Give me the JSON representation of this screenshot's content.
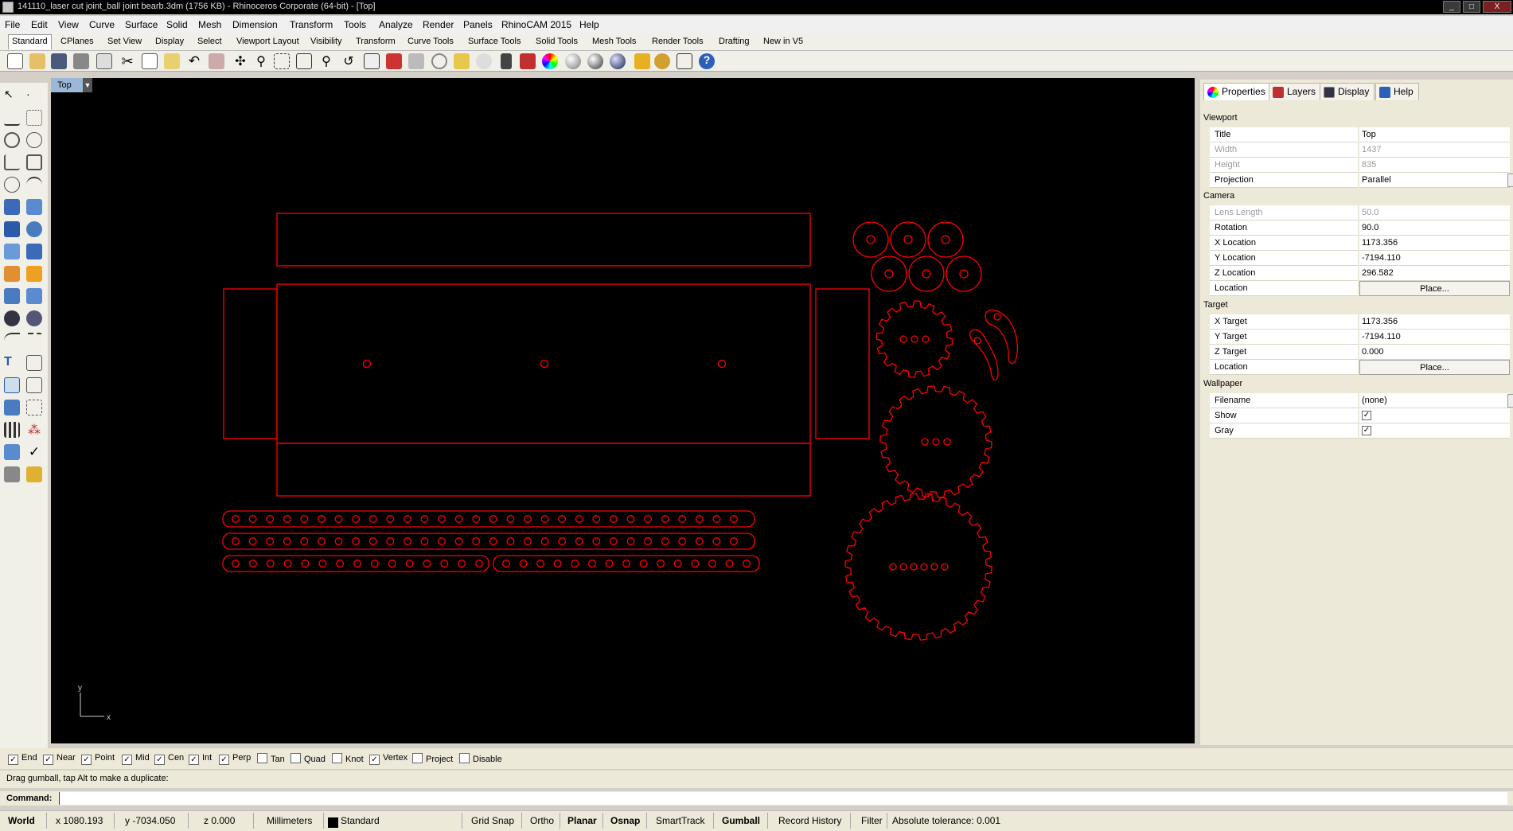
{
  "window": {
    "title": "141110_laser cut joint_ball joint bearb.3dm (1756 KB) - Rhinoceros Corporate (64-bit) - [Top]",
    "min": "_",
    "max": "□",
    "close": "X"
  },
  "menu": [
    "File",
    "Edit",
    "View",
    "Curve",
    "Surface",
    "Solid",
    "Mesh",
    "Dimension",
    "Transform",
    "Tools",
    "Analyze",
    "Render",
    "Panels",
    "RhinoCAM 2015",
    "Help"
  ],
  "toolbar_tabs": [
    "Standard",
    "CPlanes",
    "Set View",
    "Display",
    "Select",
    "Viewport Layout",
    "Visibility",
    "Transform",
    "Curve Tools",
    "Surface Tools",
    "Solid Tools",
    "Mesh Tools",
    "Render Tools",
    "Drafting",
    "New in V5"
  ],
  "viewport": {
    "label": "Top",
    "axis_x": "x",
    "axis_y": "y"
  },
  "panel": {
    "tabs": [
      "Properties",
      "Layers",
      "Display",
      "Help"
    ],
    "sections": {
      "viewport": "Viewport",
      "camera": "Camera",
      "target": "Target",
      "wallpaper": "Wallpaper"
    },
    "viewport": [
      {
        "k": "Title",
        "v": "Top"
      },
      {
        "k": "Width",
        "v": "1437"
      },
      {
        "k": "Height",
        "v": "835"
      },
      {
        "k": "Projection",
        "v": "Parallel"
      }
    ],
    "camera": [
      {
        "k": "Lens Length",
        "v": "50.0"
      },
      {
        "k": "Rotation",
        "v": "90.0"
      },
      {
        "k": "X Location",
        "v": "1173.356"
      },
      {
        "k": "Y Location",
        "v": "-7194.110"
      },
      {
        "k": "Z Location",
        "v": "296.582"
      },
      {
        "k": "Location",
        "v": "Place..."
      }
    ],
    "target": [
      {
        "k": "X Target",
        "v": "1173.356"
      },
      {
        "k": "Y Target",
        "v": "-7194.110"
      },
      {
        "k": "Z Target",
        "v": "0.000"
      },
      {
        "k": "Location",
        "v": "Place..."
      }
    ],
    "wallpaper": [
      {
        "k": "Filename",
        "v": "(none)"
      },
      {
        "k": "Show",
        "v": "✓"
      },
      {
        "k": "Gray",
        "v": "✓"
      }
    ]
  },
  "osnap": [
    {
      "label": "End",
      "checked": "✓"
    },
    {
      "label": "Near",
      "checked": "✓"
    },
    {
      "label": "Point",
      "checked": "✓"
    },
    {
      "label": "Mid",
      "checked": "✓"
    },
    {
      "label": "Cen",
      "checked": "✓"
    },
    {
      "label": "Int",
      "checked": "✓"
    },
    {
      "label": "Perp",
      "checked": "✓"
    },
    {
      "label": "Tan",
      "checked": ""
    },
    {
      "label": "Quad",
      "checked": ""
    },
    {
      "label": "Knot",
      "checked": ""
    },
    {
      "label": "Vertex",
      "checked": "✓"
    },
    {
      "label": "Project",
      "checked": ""
    },
    {
      "label": "Disable",
      "checked": ""
    }
  ],
  "command": {
    "history": "Drag gumball, tap Alt to make a duplicate:",
    "prompt": "Command:"
  },
  "status": {
    "cplane": "World",
    "x": "x 1080.193",
    "y": "y -7034.050",
    "z": "z 0.000",
    "units": "Millimeters",
    "layer": "Standard",
    "grid_snap": "Grid Snap",
    "ortho": "Ortho",
    "planar": "Planar",
    "osnap": "Osnap",
    "smarttrack": "SmartTrack",
    "gumball": "Gumball",
    "record_history": "Record History",
    "filter": "Filter",
    "tolerance": "Absolute tolerance: 0.001"
  },
  "colors": {
    "geometry": "#ff0000",
    "viewport_bg": "#000000",
    "layer_swatch": "#000000"
  }
}
